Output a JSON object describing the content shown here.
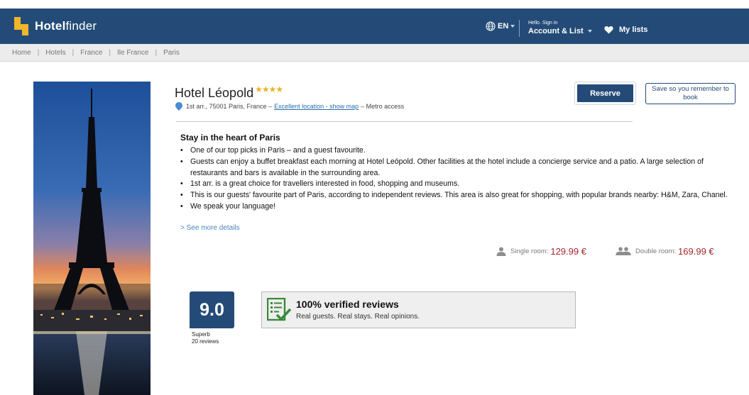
{
  "header": {
    "brand_bold": "Hotel",
    "brand_light": "finder",
    "language": "EN",
    "account_small": "Hello. Sign in",
    "account_label": "Account & List",
    "mylists_label": "My lists"
  },
  "breadcrumb": [
    "Home",
    "Hotels",
    "France",
    "Ile France",
    "Paris"
  ],
  "hotel": {
    "name": "Hotel Léopold",
    "stars": "★★★★",
    "address": "1st arr., 75001 Paris, France –",
    "map_link": "Excellent location - show map",
    "address_suffix": "– Metro access"
  },
  "actions": {
    "reserve_label": "Reserve",
    "save_label": "Save so you remember to book"
  },
  "description": {
    "title": "Stay in the heart of Paris",
    "bullets": [
      "One of our top picks in Paris – and a guest favourite.",
      "Guests can enjoy a buffet breakfast each morning at Hotel Leópold. Other facilities at the hotel include a concierge service and a patio. A large selection of restaurants and bars is available in the surrounding area.",
      "1st arr. is a great choice for travellers interested in food, shopping and museums.",
      "This is our guests' favourite part of Paris, according to independent reviews. This area is also great for shopping, with popular brands nearby: H&M, Zara, Chanel.",
      "We speak your language!"
    ],
    "see_more": "> See more details"
  },
  "prices": {
    "single_label": "Single room:",
    "single_amount": "129.99 €",
    "double_label": "Double room:",
    "double_amount": "169.99 €"
  },
  "rating": {
    "score": "9.0",
    "word": "Superb",
    "count": "20 reviews"
  },
  "verified": {
    "title": "100% verified reviews",
    "subtitle": "Real guests. Real stays. Real opinions."
  },
  "colors": {
    "brand_blue": "#244b77",
    "logo_yellow": "#f3b628",
    "price_red": "#a3262a",
    "link_blue": "#2a6ea8",
    "verified_green": "#3a8a3a"
  }
}
